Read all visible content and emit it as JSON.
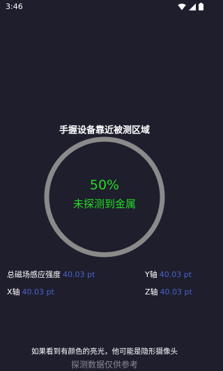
{
  "status_bar": {
    "time": "3:46",
    "icons": [
      "wifi-icon",
      "signal-icon",
      "battery-icon"
    ]
  },
  "heading": "手握设备靠近被测区域",
  "gauge": {
    "percent_text": "50%",
    "status_text": "未探测到金属",
    "progress_fraction": 0.5,
    "ring_color": "#8a8a8a",
    "text_color": "#22dd22"
  },
  "readings": {
    "total": {
      "label": "总磁场感应强度",
      "value": "40.03 pt"
    },
    "y": {
      "label": "Y轴",
      "value": "40.03 pt"
    },
    "x": {
      "label": "X轴",
      "value": "40.03 pt"
    },
    "z": {
      "label": "Z轴",
      "value": "40.03 pt"
    }
  },
  "hint": "如果看到有颜色的亮光，他可能是隐形摄像头",
  "footer": "探测数据仅供参考",
  "colors": {
    "background": "#1e1e2d",
    "value_accent": "#4a63c9"
  }
}
